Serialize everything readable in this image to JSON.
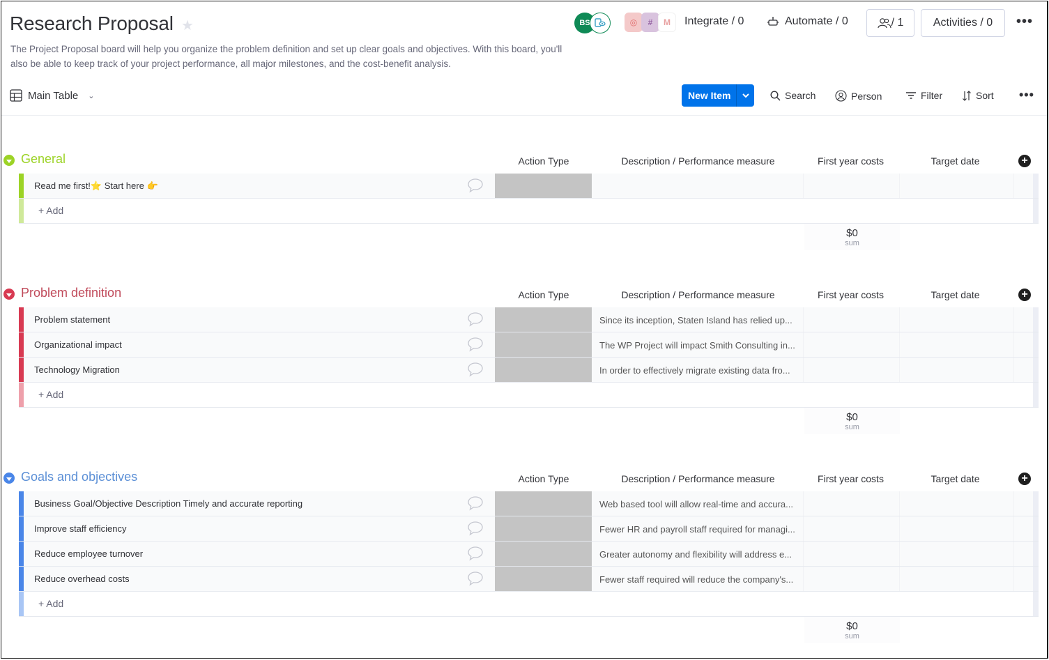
{
  "board": {
    "title": "Research Proposal",
    "description": "The Project Proposal board will help you organize the problem definition and set up clear goals and objectives. With this board, you'll also be able to keep track of your project performance, all major milestones, and the cost-benefit analysis."
  },
  "topbar": {
    "avatar_initials": "BS",
    "integrate_label": "Integrate / 0",
    "automate_label": "Automate / 0",
    "members_label": "/ 1",
    "activities_label": "Activities / 0",
    "more_label": "•••"
  },
  "viewbar": {
    "view_label": "Main Table",
    "new_item_label": "New Item",
    "search_label": "Search",
    "person_label": "Person",
    "filter_label": "Filter",
    "sort_label": "Sort",
    "more_label": "•••"
  },
  "columns": {
    "action": "Action Type",
    "desc": "Description / Performance measure",
    "cost": "First year costs",
    "date": "Target date"
  },
  "add_label": "+ Add",
  "groups": [
    {
      "title": "General",
      "color": "#9cd326",
      "light_color": "#cfe99a",
      "title_color": "#9cd326",
      "items": [
        {
          "name": "Read me first!",
          "emoji1": "⭐",
          "name2": "Start here",
          "emoji2": "👉",
          "desc": ""
        }
      ],
      "sum_value": "$0",
      "sum_label": "sum"
    },
    {
      "title": "Problem definition",
      "color": "#d83a52",
      "light_color": "#eea0ab",
      "title_color": "#c04a5a",
      "items": [
        {
          "name": "Problem statement",
          "desc": "Since its inception, Staten Island has relied up..."
        },
        {
          "name": "Organizational impact",
          "desc": "The WP Project will impact Smith Consulting in..."
        },
        {
          "name": "Technology Migration",
          "desc": "In order to effectively migrate existing data fro..."
        }
      ],
      "sum_value": "$0",
      "sum_label": "sum"
    },
    {
      "title": "Goals and objectives",
      "color": "#4a86e8",
      "light_color": "#a9c6f5",
      "title_color": "#5b8fd6",
      "items": [
        {
          "name": "Business Goal/Objective Description Timely and accurate reporting",
          "desc": "Web based tool will allow real-time and accura..."
        },
        {
          "name": "Improve staff efficiency",
          "desc": "Fewer HR and payroll staff required for managi..."
        },
        {
          "name": "Reduce employee turnover",
          "desc": "Greater autonomy and flexibility will address e..."
        },
        {
          "name": "Reduce overhead costs",
          "desc": "Fewer staff required will reduce the company's..."
        }
      ],
      "sum_value": "$0",
      "sum_label": "sum"
    }
  ]
}
